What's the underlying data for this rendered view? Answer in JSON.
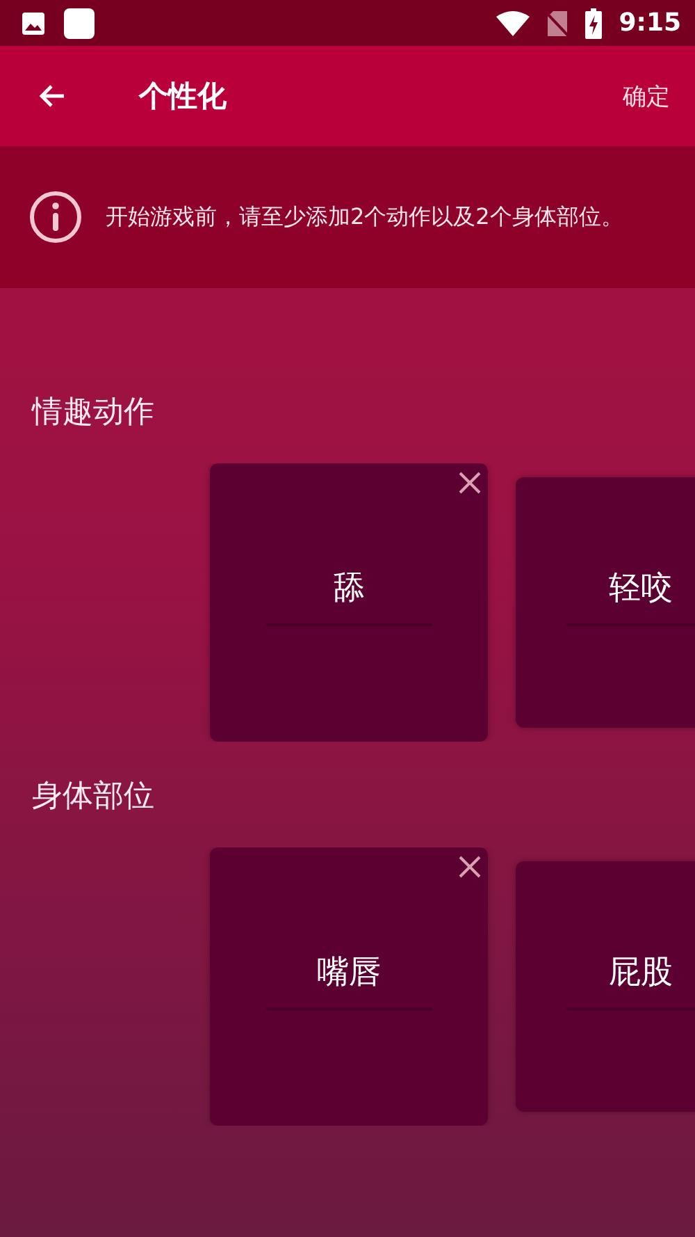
{
  "status_bar": {
    "time": "9:15"
  },
  "toolbar": {
    "title": "个性化",
    "action": "确定"
  },
  "notice": {
    "text": "开始游戏前，请至少添加2个动作以及2个身体部位。"
  },
  "sections": [
    {
      "title": "情趣动作",
      "cards": [
        {
          "label": "舔",
          "selected": true
        },
        {
          "label": "轻咬",
          "selected": false
        }
      ]
    },
    {
      "title": "身体部位",
      "cards": [
        {
          "label": "嘴唇",
          "selected": true
        },
        {
          "label": "屁股",
          "selected": false
        }
      ]
    }
  ]
}
